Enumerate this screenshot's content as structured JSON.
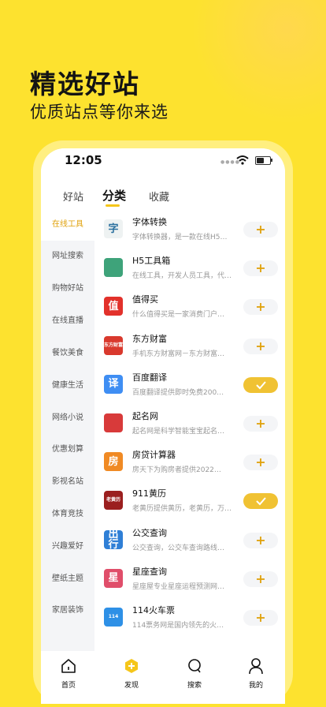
{
  "hero": {
    "title": "精选好站",
    "subtitle": "优质站点等你来选"
  },
  "status": {
    "time": "12:05"
  },
  "tabs": [
    {
      "label": "好站"
    },
    {
      "label": "分类"
    },
    {
      "label": "收藏"
    }
  ],
  "sidebar": [
    {
      "label": "在线工具"
    },
    {
      "label": "网址搜索"
    },
    {
      "label": "购物好站"
    },
    {
      "label": "在线直播"
    },
    {
      "label": "餐饮美食"
    },
    {
      "label": "健康生活"
    },
    {
      "label": "网络小说"
    },
    {
      "label": "优惠划算"
    },
    {
      "label": "影视名站"
    },
    {
      "label": "体育竞技"
    },
    {
      "label": "兴趣爱好"
    },
    {
      "label": "壁纸主题"
    },
    {
      "label": "家居装饰"
    }
  ],
  "sites": [
    {
      "name": "字体转换",
      "desc": "字体转换器，是一款在线H5…",
      "added": false,
      "icon": "zi-icon",
      "color": "#eef2f2",
      "glyph": "字"
    },
    {
      "name": "H5工具箱",
      "desc": "在线工具，开发人员工具，代…",
      "added": false,
      "icon": "toolbox-icon",
      "color": "#3ea37a",
      "glyph": ""
    },
    {
      "name": "值得买",
      "desc": "什么值得买是一家消费门户…",
      "added": false,
      "icon": "zhi-icon",
      "color": "#e2312b",
      "glyph": "值"
    },
    {
      "name": "东方财富",
      "desc": "手机东方财富网－东方财富…",
      "added": false,
      "icon": "eastmoney-icon",
      "color": "#d9392d",
      "glyph": "东方财富"
    },
    {
      "name": "百度翻译",
      "desc": "百度翻译提供即时免费200…",
      "added": true,
      "icon": "translate-icon",
      "color": "#3f8ef3",
      "glyph": "译"
    },
    {
      "name": "起名网",
      "desc": "起名网是科学智能宝宝起名…",
      "added": false,
      "icon": "qiming-icon",
      "color": "#d83a3a",
      "glyph": ""
    },
    {
      "name": "房贷计算器",
      "desc": "房天下为购房者提供2022…",
      "added": false,
      "icon": "fang-icon",
      "color": "#f08a24",
      "glyph": "房"
    },
    {
      "name": "911黄历",
      "desc": "老黄历提供黄历，老黄历，万…",
      "added": true,
      "icon": "huangli-icon",
      "color": "#9b1f1f",
      "glyph": "老黄历"
    },
    {
      "name": "公交查询",
      "desc": "公交查询，公交车查询路线…",
      "added": false,
      "icon": "bus-icon",
      "color": "#2f7fd6",
      "glyph": "出行"
    },
    {
      "name": "星座查询",
      "desc": "星座屋专业星座运程预测网…",
      "added": false,
      "icon": "star-sign-icon",
      "color": "#e04e6a",
      "glyph": "星"
    },
    {
      "name": "114火车票",
      "desc": "114票务网是国内领先的火…",
      "added": false,
      "icon": "train-icon",
      "color": "#2e90e6",
      "glyph": "114"
    }
  ],
  "nav": [
    {
      "label": "首页"
    },
    {
      "label": "发现"
    },
    {
      "label": "搜索"
    },
    {
      "label": "我的"
    }
  ],
  "colors": {
    "accent": "#f0c233",
    "background": "#fde22f"
  }
}
